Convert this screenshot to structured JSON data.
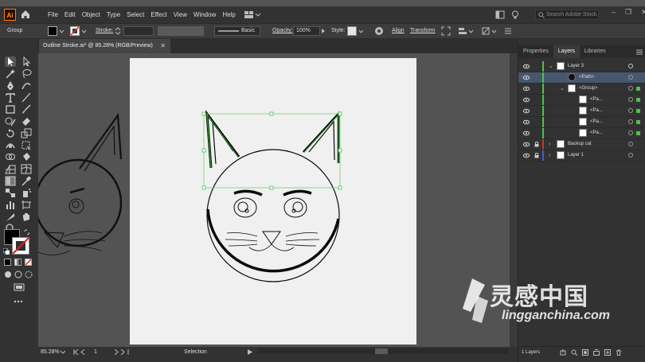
{
  "app": {
    "logo": "Ai",
    "menus": [
      "File",
      "Edit",
      "Object",
      "Type",
      "Select",
      "Effect",
      "View",
      "Window",
      "Help"
    ],
    "search_placeholder": "Search Adobe Stock",
    "window_controls": [
      "–",
      "❐",
      "✕"
    ]
  },
  "control_bar": {
    "selection_type": "Group",
    "stroke_label": "Stroke:",
    "brush_profile": "Basic",
    "opacity_label": "Opacity:",
    "opacity_value": "100%",
    "style_label": "Style:",
    "align_label": "Align",
    "transform_label": "Transform"
  },
  "document": {
    "tab_title": "Outline Stroke.ai* @ 85.28% (RGB/Preview)",
    "close_glyph": "✕"
  },
  "status_bar": {
    "zoom": "85.28%",
    "artboard_number": "1",
    "tool_status": "Selection"
  },
  "panel": {
    "tabs": [
      "Properties",
      "Layers",
      "Libraries"
    ],
    "active_tab": "Layers",
    "layers": [
      {
        "name": "Layer 3",
        "indent": 0,
        "expanded": true,
        "color": "#4cc24c",
        "selected": false
      },
      {
        "name": "<Path>",
        "indent": 1,
        "expanded": false,
        "color": "#4cc24c",
        "selected": true
      },
      {
        "name": "<Group>",
        "indent": 1,
        "expanded": true,
        "color": "#4cc24c",
        "selected": false
      },
      {
        "name": "<Pa...",
        "indent": 2,
        "expanded": false,
        "color": "#4cc24c",
        "selected": false
      },
      {
        "name": "<Pa...",
        "indent": 2,
        "expanded": false,
        "color": "#4cc24c",
        "selected": false
      },
      {
        "name": "<Pa...",
        "indent": 2,
        "expanded": false,
        "color": "#4cc24c",
        "selected": false
      },
      {
        "name": "<Pa...",
        "indent": 2,
        "expanded": false,
        "color": "#4cc24c",
        "selected": false
      },
      {
        "name": "Backup cat",
        "indent": 0,
        "expanded": false,
        "color": "#d03030",
        "locked": true,
        "selected": false
      },
      {
        "name": "Layer 1",
        "indent": 0,
        "expanded": false,
        "color": "#4060d0",
        "locked": true,
        "selected": false
      }
    ],
    "layer_count": "1 Layers"
  },
  "watermark": {
    "chinese": "灵感中国",
    "url": "lingganchina.com"
  },
  "colors": {
    "accent_green": "#4cc24c",
    "selection_blue": "#46576e"
  }
}
